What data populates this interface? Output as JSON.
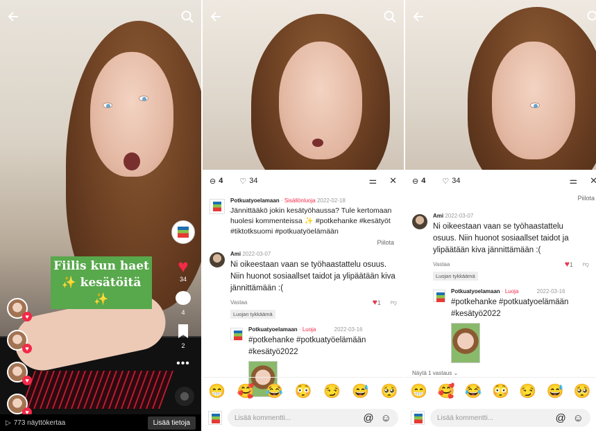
{
  "panel1": {
    "caption": [
      "Fiilis kun haet",
      "✨ kesätöitä ✨"
    ],
    "likes": "34",
    "comments": "4",
    "saves": "2",
    "views": "773 näyttökertaa",
    "more_info": "Lisää tietoja"
  },
  "sheet": {
    "comment_count": "4",
    "like_count": "34"
  },
  "panel2": {
    "c1": {
      "name": "Potkuatyoelamaan",
      "role": "Sisällönluoja",
      "date": "2022-02-18",
      "text": "Jännittääkö jokin kesätyöhaussa? Tule kertomaan huolesi kommenteissa ✨ #potkehanke #kesätyöt #tiktotksuomi #potkuatyöelämään",
      "hide": "Piilota"
    },
    "c2": {
      "name": "Ami",
      "date": "2022-03-07",
      "text": "Ni oikeestaan vaan se työhaastattelu osuus. Niin huonot sosiaallset taidot ja ylipäätään kiva jännittämään :(",
      "reply": "Vastaa",
      "likes": "1",
      "liked_by_creator": "Luojan tykkäämä"
    },
    "c3": {
      "name": "Potkuatyoelamaan",
      "role": "Luoja",
      "date": "2022-03-16",
      "text": "#potkehanke #potkuatyöelämään #kesätyö2022"
    }
  },
  "panel3": {
    "hide": "Piilota",
    "c2": {
      "name": "Ami",
      "date": "2022-03-07",
      "text": "Ni oikeestaan vaan se työhaastattelu osuus. Niin huonot sosiaallset taidot ja ylipäätään kiva jännittämään :(",
      "reply": "Vastaa",
      "likes": "1",
      "liked_by_creator": "Luojan tykkäämä"
    },
    "c3": {
      "name": "Potkuatyoelamaan",
      "role": "Luoja",
      "date": "2022-03-16",
      "text": "#potkehanke #potkuatyoelämään #kesätyö2022"
    },
    "show_replies": "Näytä 1 vastaus"
  },
  "emojis": [
    "😁",
    "🥰",
    "😂",
    "😳",
    "😏",
    "😅",
    "🥺"
  ],
  "input": {
    "placeholder": "Lisää kommentti...",
    "at": "@",
    "emoji": "☺"
  },
  "icons": {
    "back": "arrow-back-icon",
    "search": "search-icon",
    "close": "close-icon",
    "filter": "filter-icon"
  },
  "colors": {
    "accent": "#f22a47",
    "caption_bg": "#58a84c"
  }
}
